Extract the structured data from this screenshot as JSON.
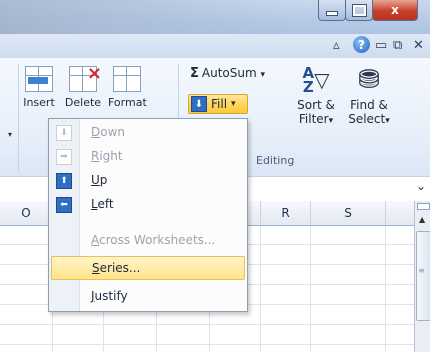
{
  "window": {
    "min_icon": "minimize-icon",
    "max_icon": "maximize-icon",
    "close_glyph": "x"
  },
  "tabrow": {
    "icons": [
      "caret-icon",
      "help-icon",
      "ribbon-minimize-icon",
      "restore-icon",
      "close-icon"
    ],
    "help_glyph": "?"
  },
  "ribbon": {
    "insert": "Insert",
    "delete": "Delete",
    "format": "Format",
    "autosum": "AutoSum",
    "autosum_caret": "▾",
    "fill": "Fill",
    "fill_caret": "▾",
    "sort_line1": "Sort &",
    "sort_line2": "Filter",
    "find_line1": "Find &",
    "find_line2": "Select",
    "dropdown_caret": "▾",
    "group_label": "Editing"
  },
  "fill_menu": {
    "items": [
      {
        "label": "Down",
        "accel": "D",
        "enabled": false
      },
      {
        "label": "Right",
        "accel": "R",
        "enabled": false
      },
      {
        "label": "Up",
        "accel": "U",
        "enabled": true
      },
      {
        "label": "Left",
        "accel": "L",
        "enabled": true
      },
      {
        "label": "Across Worksheets...",
        "accel": "A",
        "enabled": false
      },
      {
        "label": "Series...",
        "accel": "S",
        "enabled": true,
        "highlighted": true
      },
      {
        "label": "Justify",
        "accel": "J",
        "enabled": true
      }
    ]
  },
  "columns": [
    "O",
    "R",
    "S"
  ],
  "scrollbar": {
    "grip": "≡"
  }
}
